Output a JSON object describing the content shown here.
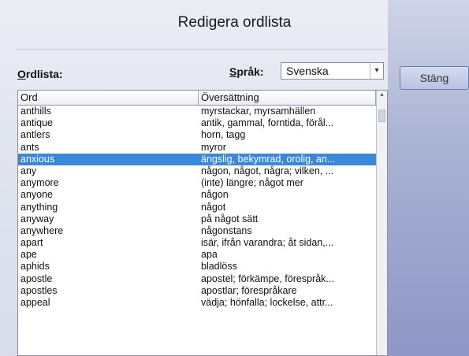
{
  "dialog": {
    "title": "Redigera ordlista"
  },
  "labels": {
    "ordlista_first": "O",
    "ordlista_rest": "rdlista:",
    "sprak_first": "S",
    "sprak_rest": "pråk:"
  },
  "language_select": {
    "value": "Svenska",
    "arrow": "▾"
  },
  "buttons": {
    "close": "Stäng"
  },
  "table": {
    "headers": {
      "word": "Ord",
      "translation": "Översättning"
    },
    "selected_index": 4,
    "rows": [
      {
        "word": "anthills",
        "translation": "myrstackar, myrsamhällen"
      },
      {
        "word": "antique",
        "translation": "antik, gammal, forntida, förål..."
      },
      {
        "word": "antlers",
        "translation": "horn, tagg"
      },
      {
        "word": "ants",
        "translation": "myror"
      },
      {
        "word": "anxious",
        "translation": "ängslig, bekymrad, orolig, an..."
      },
      {
        "word": "any",
        "translation": "någon, något, några; vilken, ..."
      },
      {
        "word": "anymore",
        "translation": "(inte) längre; något mer"
      },
      {
        "word": "anyone",
        "translation": "någon"
      },
      {
        "word": "anything",
        "translation": "något"
      },
      {
        "word": "anyway",
        "translation": "på något sätt"
      },
      {
        "word": "anywhere",
        "translation": "någonstans"
      },
      {
        "word": "apart",
        "translation": "isär, ifrån varandra; åt sidan,..."
      },
      {
        "word": "ape",
        "translation": "apa"
      },
      {
        "word": "aphids",
        "translation": "bladlöss"
      },
      {
        "word": "apostle",
        "translation": "apostel; förkämpe, förespråk..."
      },
      {
        "word": "apostles",
        "translation": "apostlar; förespråkare"
      },
      {
        "word": "appeal",
        "translation": "vädja; hönfalla; lockelse, attr..."
      }
    ]
  }
}
